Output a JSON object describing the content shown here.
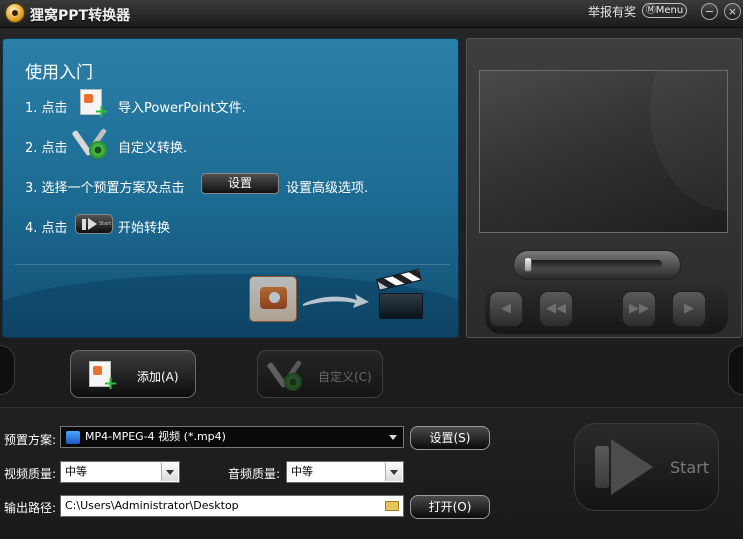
{
  "window": {
    "title": "狸窝PPT转换器",
    "report_label": "举报有奖",
    "menu_label": "Menu",
    "minimize_glyph": "−",
    "close_glyph": "×"
  },
  "intro": {
    "title": "使用入门",
    "step1_prefix": "1. 点击",
    "step1_text": "导入PowerPoint文件.",
    "step2_prefix": "2. 点击",
    "step2_text": "自定义转换.",
    "step3_prefix": "3. 选择一个预置方案及点击",
    "step3_button": "设置",
    "step3_text": "设置高级选项.",
    "step4_prefix": "4. 点击",
    "step4_button": "Start",
    "step4_text": "开始转换"
  },
  "player": {
    "buttons": [
      "prev-icon",
      "rewind-icon",
      "fast-forward-icon",
      "next-icon"
    ]
  },
  "actions": {
    "add_label": "添加(A)",
    "custom_label": "自定义(C)"
  },
  "settings": {
    "preset_label": "预置方案:",
    "preset_value": "MP4-MPEG-4 视频 (*.mp4)",
    "settings_button": "设置(S)",
    "video_quality_label": "视频质量:",
    "video_quality_value": "中等",
    "audio_quality_label": "音频质量:",
    "audio_quality_value": "中等",
    "output_label": "输出路径:",
    "output_value": "C:\\Users\\Administrator\\Desktop",
    "open_button": "打开(O)",
    "start_label": "Start"
  },
  "colors": {
    "intro_panel": "#1c6a92",
    "background": "#1c1c1c"
  }
}
